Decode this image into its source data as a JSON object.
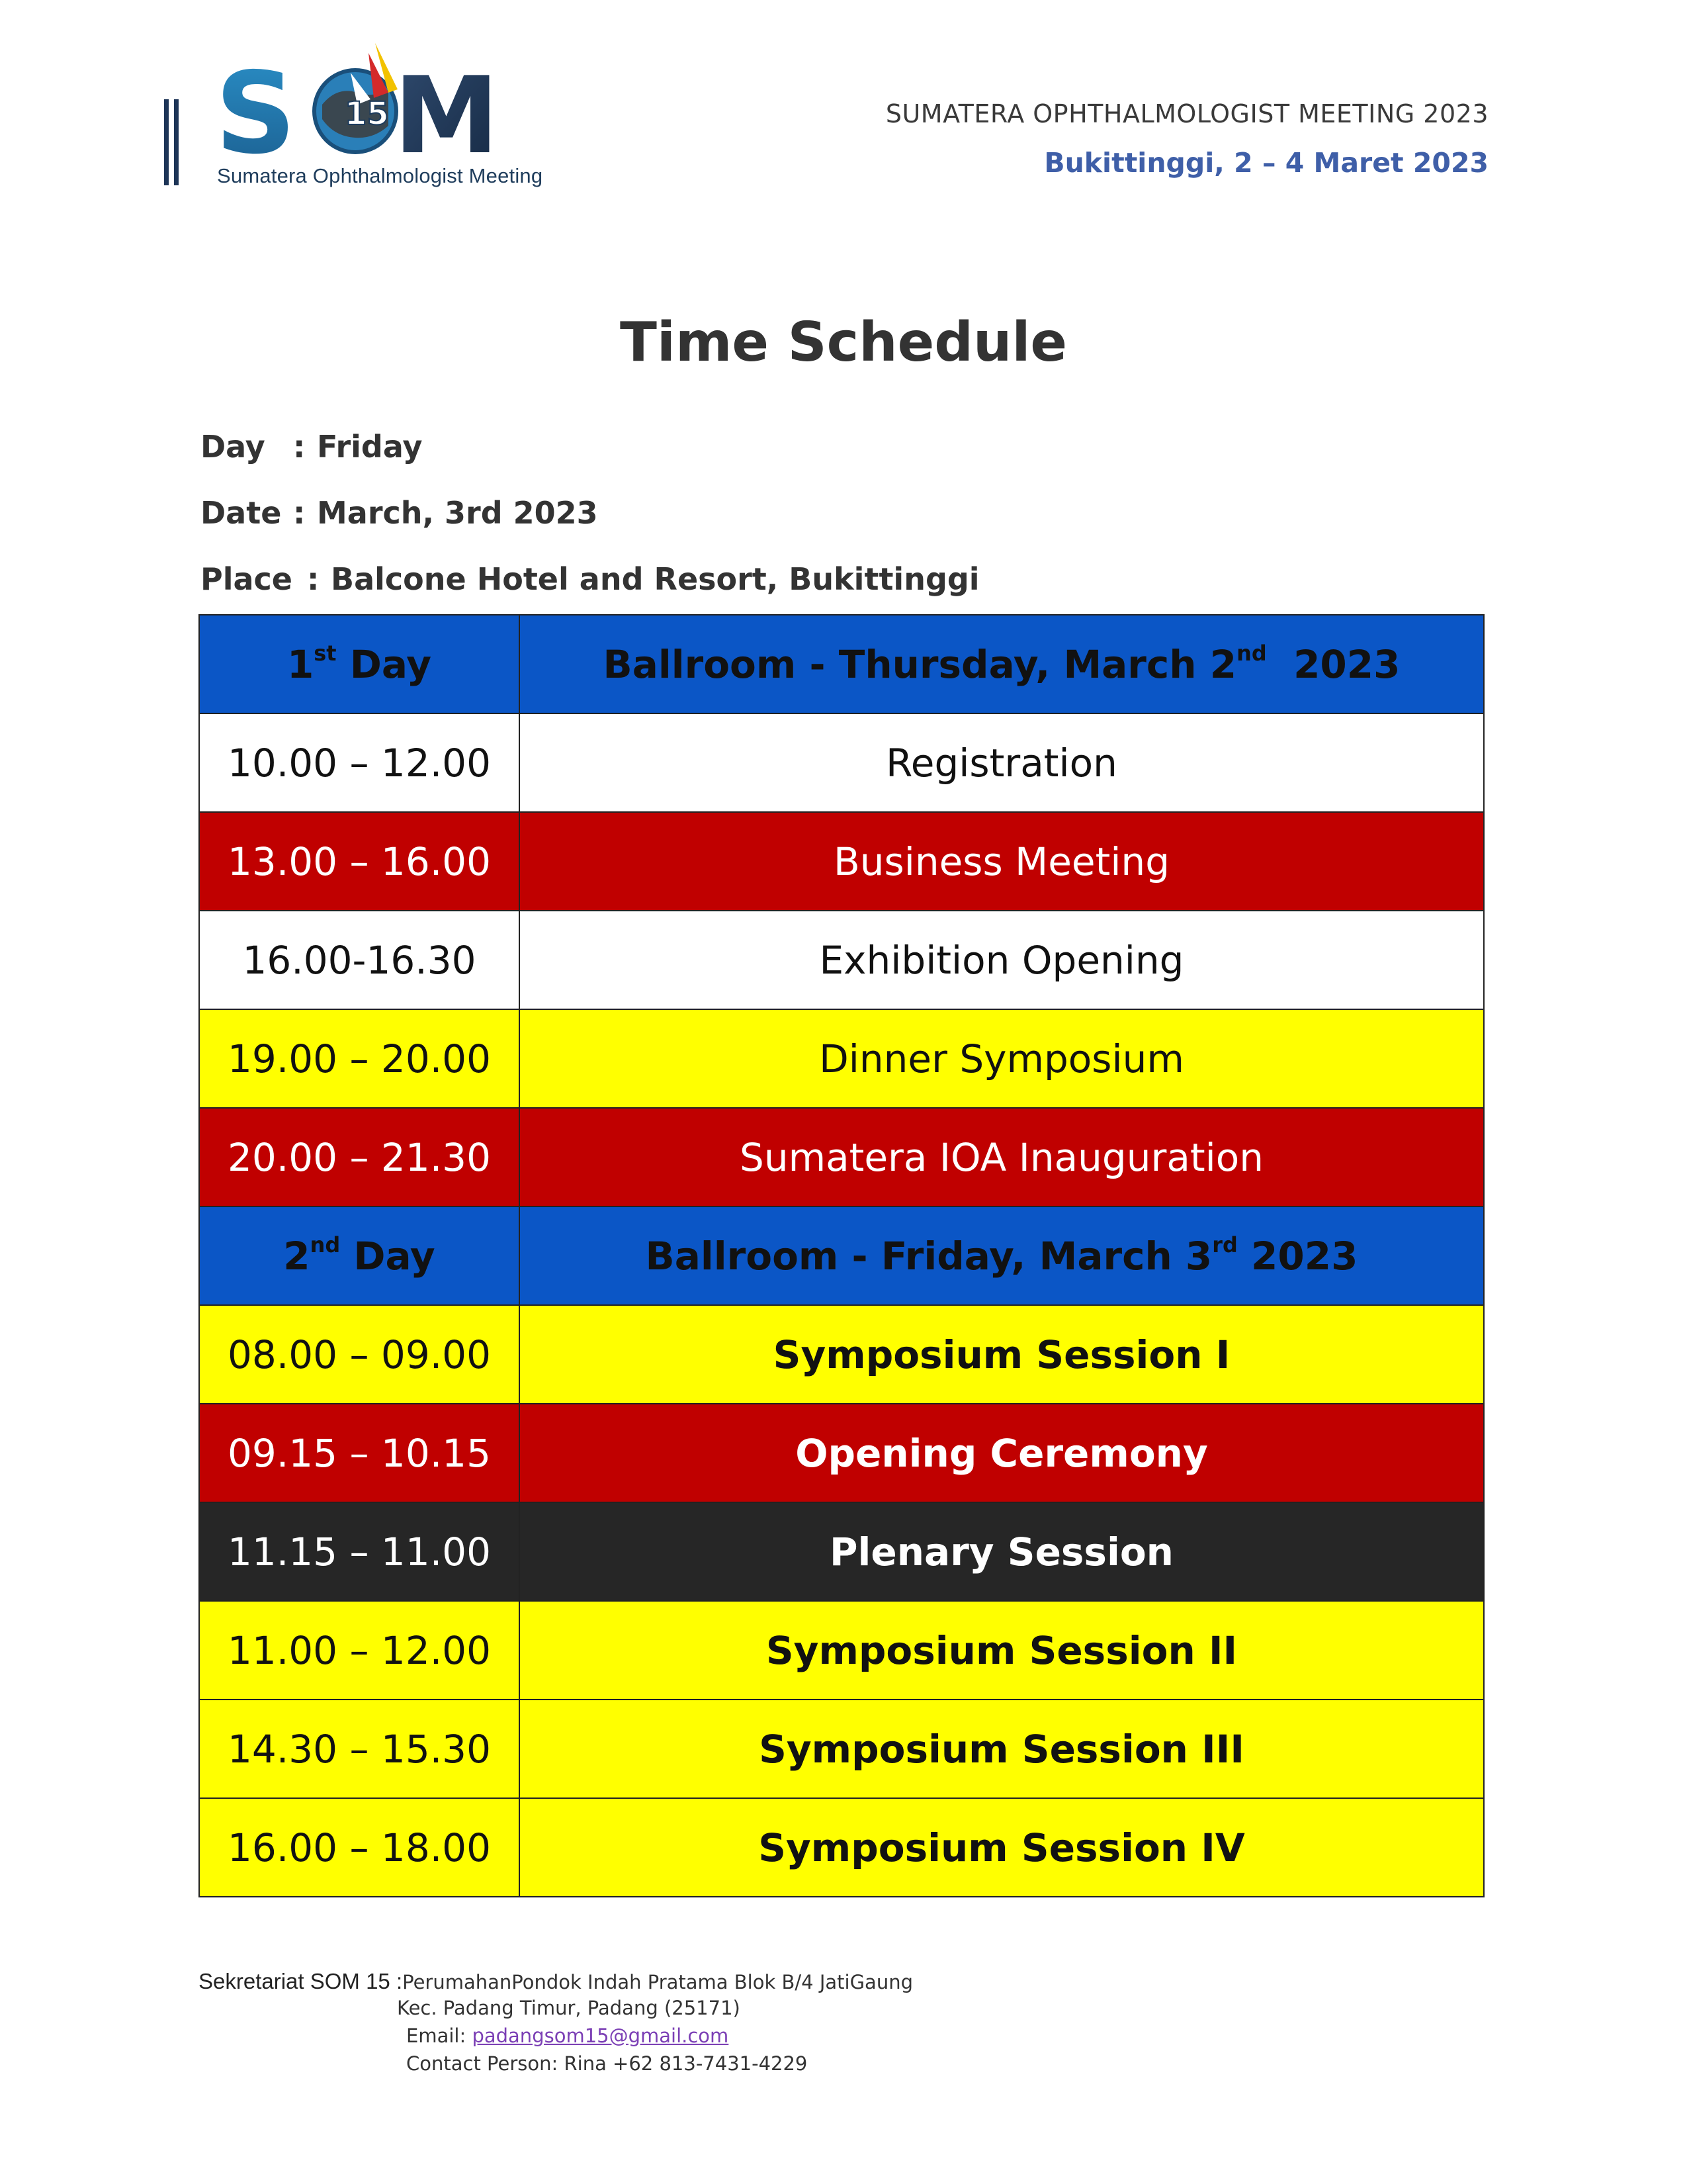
{
  "header": {
    "logo_text": "SOM",
    "logo_badge": "15",
    "logo_tagline": "Sumatera Ophthalmologist Meeting",
    "event_name": "SUMATERA OPHTHALMOLOGIST MEETING 2023",
    "event_place": "Bukittinggi, 2 – 4 Maret 2023"
  },
  "colors": {
    "blue": "#0b56c6",
    "red": "#c00000",
    "yellow": "#ffff00",
    "black": "#262626",
    "white": "#ffffff",
    "accent_header": "#3f5fa8"
  },
  "title": "Time Schedule",
  "info": {
    "day_label": "Day",
    "day_value": "Friday",
    "date_label": "Date",
    "date_value": "March, 3rd 2023",
    "place_label": "Place",
    "place_value": "Balcone Hotel and Resort, Bukittinggi",
    "separator": ":"
  },
  "schedule": {
    "day1": {
      "num": "1",
      "num_sup": "st",
      "word": "Day",
      "venue_pre": "Ballroom  - Thursday, March 2",
      "venue_sup": "nd",
      "venue_post": "  2023"
    },
    "day2": {
      "num": "2",
      "num_sup": "nd",
      "word": "Day",
      "venue_pre": "Ballroom  - Friday, March 3",
      "venue_sup": "rd",
      "venue_post": " 2023"
    },
    "rows": [
      {
        "time": "10.00 – 12.00",
        "activity": "Registration"
      },
      {
        "time": "13.00 – 16.00",
        "activity": "Business Meeting"
      },
      {
        "time": "16.00-16.30",
        "activity": "Exhibition Opening"
      },
      {
        "time": "19.00 – 20.00",
        "activity": "Dinner Symposium"
      },
      {
        "time": "20.00 – 21.30",
        "activity": "Sumatera IOA Inauguration"
      },
      {
        "time": "08.00 – 09.00",
        "activity": "Symposium Session I"
      },
      {
        "time": "09.15 – 10.15",
        "activity": "Opening Ceremony"
      },
      {
        "time": "11.15 – 11.00",
        "activity": "Plenary Session"
      },
      {
        "time": "11.00 – 12.00",
        "activity": "Symposium Session II"
      },
      {
        "time": "14.30 – 15.30",
        "activity": "Symposium Session III"
      },
      {
        "time": "16.00 – 18.00",
        "activity": "Symposium Session IV"
      }
    ]
  },
  "footer": {
    "lead": "Sekretariat SOM 15 :",
    "address1": "PerumahanPondok Indah Pratama Blok B/4 JatiGaung",
    "address2": "Kec. Padang Timur, Padang (25171)",
    "email_label": "Email: ",
    "email": "padangsom15@gmail.com",
    "contact": "Contact Person: Rina  +62 813-7431-4229"
  }
}
